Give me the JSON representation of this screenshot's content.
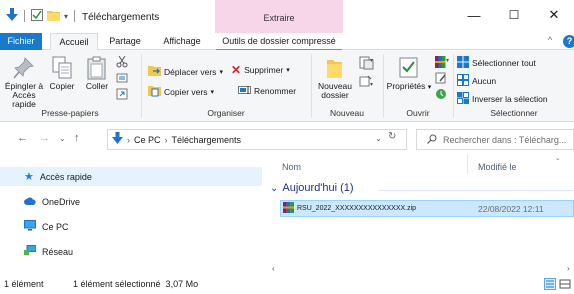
{
  "window": {
    "title": "Téléchargements",
    "contextual_tab_group": "Extraire",
    "minimize": "—",
    "maximize": "☐",
    "close": "✕"
  },
  "tabs": [
    {
      "label": "Fichier"
    },
    {
      "label": "Accueil"
    },
    {
      "label": "Partage"
    },
    {
      "label": "Affichage"
    },
    {
      "label": "Outils de dossier compressé"
    }
  ],
  "ribbon": {
    "collapse": "^",
    "help": "?",
    "groups": {
      "clipboard": {
        "label": "Presse-papiers",
        "pin_label": "Épingler à Accès rapide",
        "pin_line1": "Épingler à",
        "pin_line2": "Accès rapide",
        "copy_label": "Copier",
        "paste_label": "Coller"
      },
      "organize": {
        "label": "Organiser",
        "move_to": "Déplacer vers",
        "copy_to": "Copier vers",
        "delete": "Supprimer",
        "rename": "Renommer"
      },
      "new": {
        "label": "Nouveau",
        "new_folder_line1": "Nouveau",
        "new_folder_line2": "dossier"
      },
      "open": {
        "label": "Ouvrir",
        "properties": "Propriétés"
      },
      "select": {
        "label": "Sélectionner",
        "select_all": "Sélectionner tout",
        "select_none": "Aucun",
        "invert": "Inverser la sélection"
      }
    }
  },
  "address_bar": {
    "crumbs": [
      "Ce PC",
      "Téléchargements"
    ],
    "search_placeholder": "Rechercher dans : Télécharg..."
  },
  "nav_pane": {
    "items": [
      {
        "label": "Accès rapide",
        "icon": "star-icon"
      },
      {
        "label": "OneDrive",
        "icon": "cloud-icon"
      },
      {
        "label": "Ce PC",
        "icon": "computer-icon"
      },
      {
        "label": "Réseau",
        "icon": "network-icon"
      }
    ]
  },
  "content": {
    "columns": {
      "name": "Nom",
      "modified": "Modifié le"
    },
    "group": {
      "label": "Aujourd'hui (1)"
    },
    "files": [
      {
        "name": "RSU_2022_XXXXXXXXXXXXXXX.zip",
        "modified": "22/08/2022 12:11",
        "icon": "winrar-archive-icon"
      }
    ]
  },
  "status": {
    "count": "1 élément",
    "selection": "1 élément sélectionné  3,07 Mo"
  },
  "colors": {
    "accent": "#1979ca",
    "contextual": "#f7d6ea",
    "selection": "#cce8ff",
    "group_heading": "#1e3287"
  }
}
